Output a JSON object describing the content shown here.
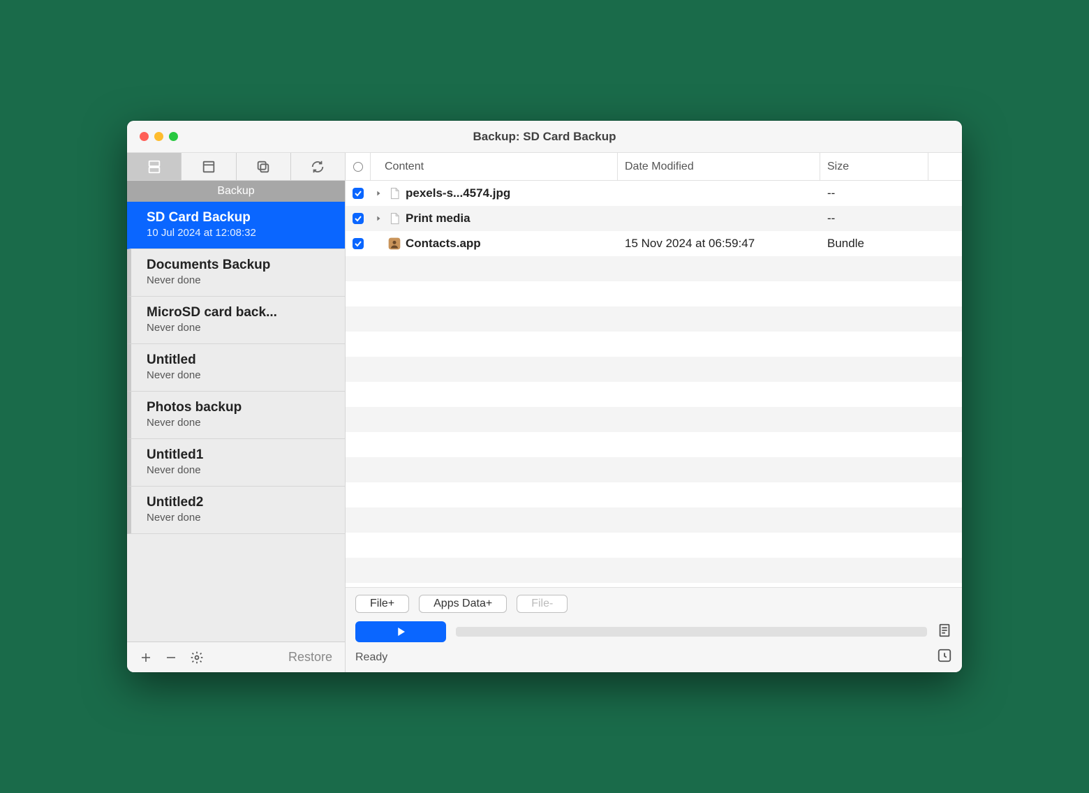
{
  "window_title": "Backup: SD Card Backup",
  "sidebar": {
    "section_label": "Backup",
    "tasks": [
      {
        "title": "SD Card Backup",
        "subtitle": "10 Jul 2024 at 12:08:32",
        "selected": true
      },
      {
        "title": "Documents Backup",
        "subtitle": "Never done",
        "selected": false
      },
      {
        "title": "MicroSD card back...",
        "subtitle": "Never done",
        "selected": false
      },
      {
        "title": "Untitled",
        "subtitle": "Never done",
        "selected": false
      },
      {
        "title": "Photos backup",
        "subtitle": "Never done",
        "selected": false
      },
      {
        "title": "Untitled1",
        "subtitle": "Never done",
        "selected": false
      },
      {
        "title": "Untitled2",
        "subtitle": "Never done",
        "selected": false
      }
    ],
    "restore_label": "Restore"
  },
  "table": {
    "headers": {
      "content": "Content",
      "date": "Date Modified",
      "size": "Size"
    },
    "rows": [
      {
        "name": "pexels-s...4574.jpg",
        "date": "",
        "size": "--",
        "expandable": true,
        "icon": "file"
      },
      {
        "name": "Print media",
        "date": "",
        "size": "--",
        "expandable": true,
        "icon": "file"
      },
      {
        "name": "Contacts.app",
        "date": "15 Nov 2024 at 06:59:47",
        "size": "Bundle",
        "expandable": false,
        "icon": "contacts"
      }
    ]
  },
  "bottom": {
    "file_plus": "File+",
    "apps_data_plus": "Apps Data+",
    "file_minus": "File-",
    "status": "Ready"
  }
}
